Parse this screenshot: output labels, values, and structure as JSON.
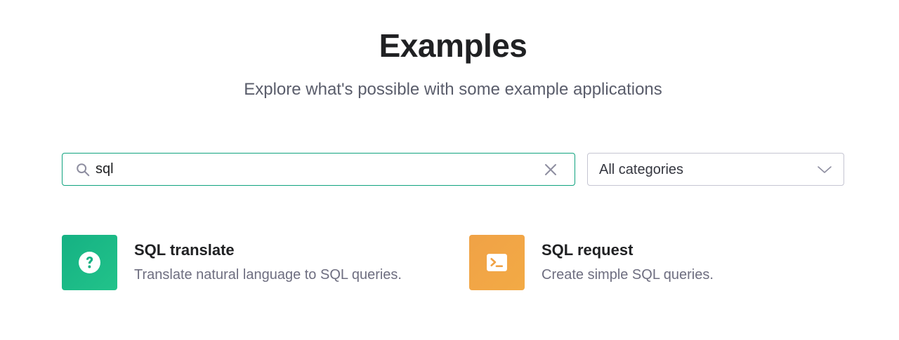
{
  "header": {
    "title": "Examples",
    "subtitle": "Explore what's possible with some example applications"
  },
  "search": {
    "value": "sql",
    "icon": "search-icon",
    "clear_icon": "close-icon"
  },
  "category_select": {
    "value": "All categories",
    "icon": "chevron-down-icon"
  },
  "results": [
    {
      "name": "SQL translate",
      "description": "Translate natural language to SQL queries.",
      "icon": "question-icon",
      "color": "#10a37f"
    },
    {
      "name": "SQL request",
      "description": "Create simple SQL queries.",
      "icon": "terminal-icon",
      "color": "#f0a246"
    }
  ],
  "colors": {
    "accent": "#10a37f",
    "border": "#c5c5d2"
  }
}
